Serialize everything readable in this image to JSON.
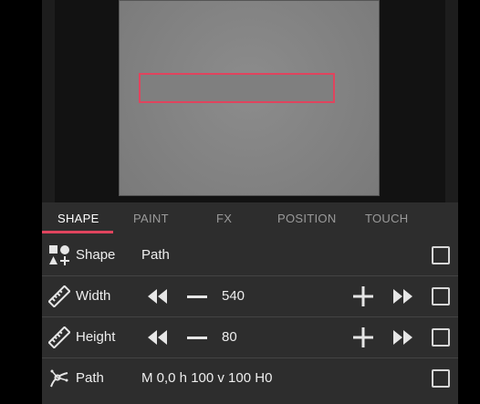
{
  "tabs": [
    {
      "label": "SHAPE",
      "active": true
    },
    {
      "label": "PAINT",
      "active": false
    },
    {
      "label": "FX",
      "active": false
    },
    {
      "label": "POSITION",
      "active": false
    },
    {
      "label": "TOUCH",
      "active": false
    }
  ],
  "rows": {
    "shape": {
      "label": "Shape",
      "value": "Path",
      "icon": "shapes-icon"
    },
    "width": {
      "label": "Width",
      "value": "540",
      "icon": "ruler-icon"
    },
    "height": {
      "label": "Height",
      "value": "80",
      "icon": "ruler-icon"
    },
    "path": {
      "label": "Path",
      "value": "M 0,0 h 100 v 100 H0",
      "icon": "bezier-path-icon"
    }
  },
  "colors": {
    "accent": "#e0445e",
    "panel": "#2d2d2d",
    "text": "#eeeeee"
  }
}
